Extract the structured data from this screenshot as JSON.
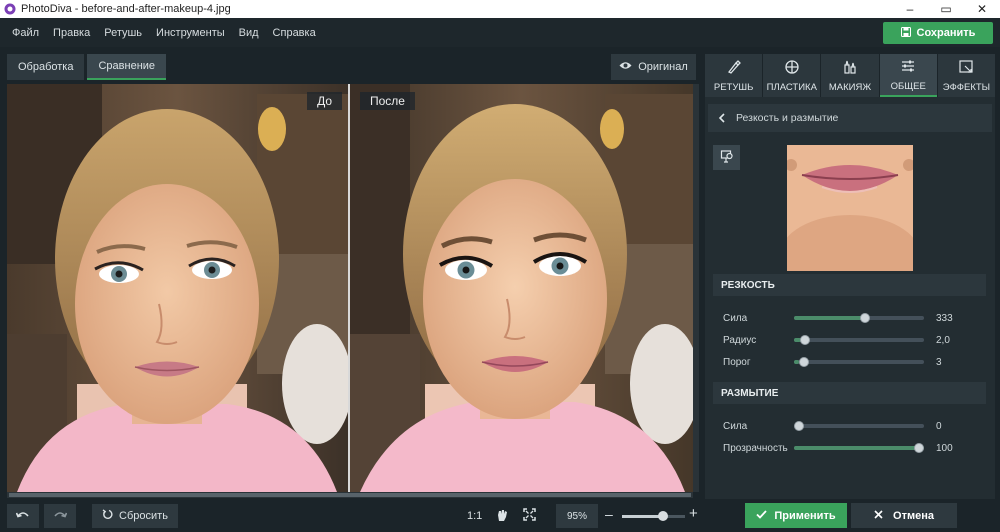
{
  "window": {
    "title": "PhotoDiva - before-and-after-makeup-4.jpg",
    "controls": {
      "minimize": "–",
      "maximize": "▭",
      "close": "✕"
    }
  },
  "menu": [
    "Файл",
    "Правка",
    "Ретушь",
    "Инструменты",
    "Вид",
    "Справка"
  ],
  "save_button": "Сохранить",
  "view_tabs": [
    "Обработка",
    "Сравнение"
  ],
  "active_view_tab": "Сравнение",
  "original_button": "Оригинал",
  "compare": {
    "before_label": "До",
    "after_label": "После"
  },
  "tool_tabs": [
    {
      "label": "РЕТУШЬ",
      "icon": "brush-icon"
    },
    {
      "label": "ПЛАСТИКА",
      "icon": "crosshair-icon"
    },
    {
      "label": "МАКИЯЖ",
      "icon": "makeup-icon"
    },
    {
      "label": "ОБЩЕЕ",
      "icon": "sliders-icon"
    },
    {
      "label": "ЭФФЕКТЫ",
      "icon": "effects-icon"
    }
  ],
  "active_tool_tab": "ОБЩЕЕ",
  "section_title": "Резкость и размытие",
  "sharpness": {
    "header": "РЕЗКОСТЬ",
    "sliders": [
      {
        "label": "Сила",
        "value": "333",
        "fraction": 0.55
      },
      {
        "label": "Радиус",
        "value": "2,0",
        "fraction": 0.05
      },
      {
        "label": "Порог",
        "value": "3",
        "fraction": 0.04
      }
    ]
  },
  "blur": {
    "header": "РАЗМЫТИЕ",
    "sliders": [
      {
        "label": "Сила",
        "value": "0",
        "fraction": 0.0
      },
      {
        "label": "Прозрачность",
        "value": "100",
        "fraction": 1.0
      }
    ]
  },
  "bottom": {
    "reset": "Сбросить",
    "ratio": "1:1",
    "zoom": "95%",
    "zoom_fraction": 0.65,
    "zoom_minus": "–",
    "zoom_plus": "+",
    "apply": "Применить",
    "cancel": "Отмена"
  },
  "colors": {
    "accent": "#3aa35c",
    "background": "#1b2429",
    "panel": "#232d32"
  }
}
